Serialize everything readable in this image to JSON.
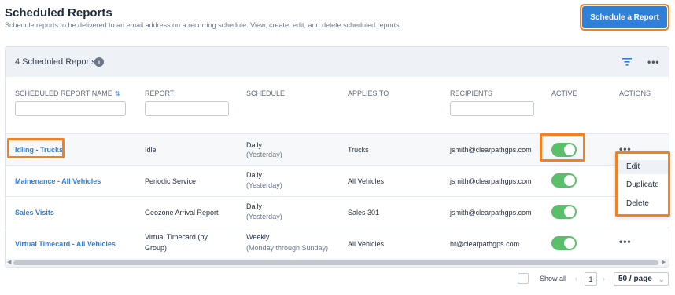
{
  "page": {
    "title": "Scheduled Reports",
    "subtitle": "Schedule reports to be delivered to an email address on a recurring schedule. View, create, edit, and delete scheduled reports.",
    "primary_button": "Schedule a Report"
  },
  "card": {
    "title": "4 Scheduled Reports",
    "info_icon": "i"
  },
  "columns": {
    "name": "SCHEDULED REPORT NAME",
    "report": "REPORT",
    "schedule": "SCHEDULE",
    "applies_to": "APPLIES TO",
    "recipients": "RECIPIENTS",
    "active": "ACTIVE",
    "actions": "ACTIONS"
  },
  "rows": [
    {
      "name": "Idling - Trucks",
      "report": "Idle",
      "schedule": "Daily",
      "schedule_detail": "(Yesterday)",
      "applies_to": "Trucks",
      "recipients": "jsmith@clearpathgps.com",
      "active": true
    },
    {
      "name": "Mainenance - All Vehicles",
      "report": "Periodic Service",
      "schedule": "Daily",
      "schedule_detail": "(Yesterday)",
      "applies_to": "All Vehicles",
      "recipients": "jsmith@clearpathgps.com",
      "active": true
    },
    {
      "name": "Sales Visits",
      "report": "Geozone Arrival Report",
      "schedule": "Daily",
      "schedule_detail": "(Yesterday)",
      "applies_to": "Sales 301",
      "recipients": "jsmith@clearpathgps.com",
      "active": true
    },
    {
      "name": "Virtual Timecard - All Vehicles",
      "report_line1": "Virtual Timecard (by",
      "report_line2": "Group)",
      "schedule": "Weekly",
      "schedule_detail": "(Monday through Sunday)",
      "applies_to": "All Vehicles",
      "recipients": "hr@clearpathgps.com",
      "active": true
    }
  ],
  "row_menu": {
    "edit": "Edit",
    "duplicate": "Duplicate",
    "delete": "Delete"
  },
  "pagination": {
    "show_all": "Show all",
    "current_page": "1",
    "page_size": "50 / page"
  },
  "colors": {
    "accent": "#2f80d9",
    "highlight": "#f48120",
    "toggle_on": "#5bbf69"
  },
  "icons": {
    "info": "info-icon",
    "filter": "filter-icon",
    "more": "more-horizontal-icon",
    "sort": "sort-icon"
  }
}
